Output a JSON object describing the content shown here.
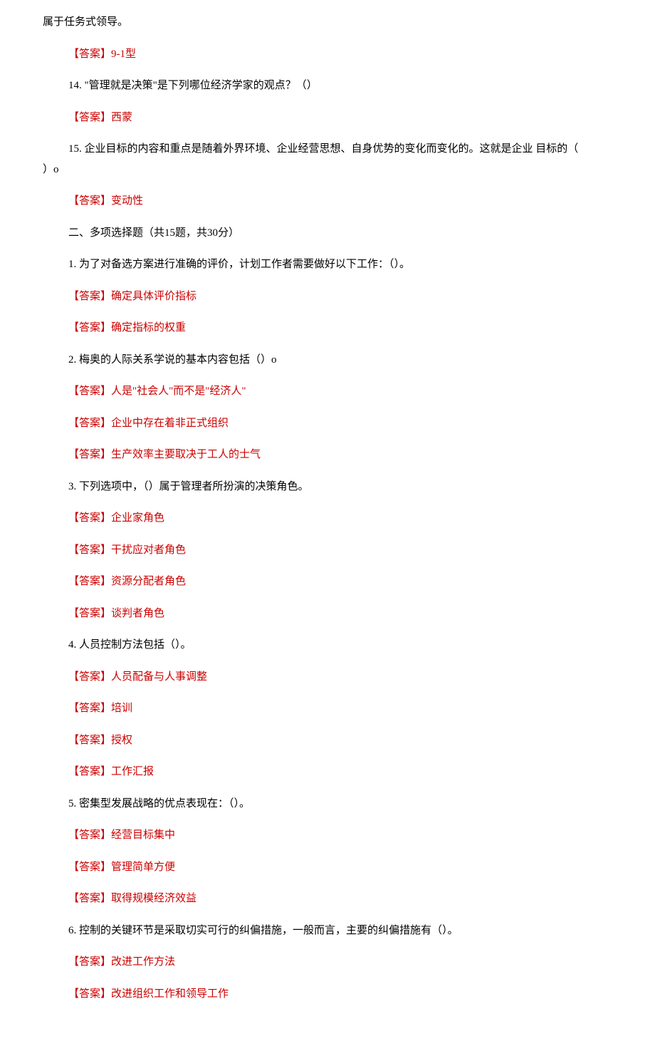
{
  "lines": {
    "l1": "属于任务式领导。",
    "l2_tag": "【答案】",
    "l2_ans": "9-1型",
    "l3": "14. \"管理就是决策\"是下列哪位经济学家的观点？（）",
    "l4_tag": "【答案】",
    "l4_ans": "西蒙",
    "l5a": "15. 企业目标的内容和重点是随着外界环境、企业经营思想、自身优势的变化而变化的。这就是企业 目标的（",
    "l5b": "）o",
    "l6_tag": "【答案】",
    "l6_ans": "变动性",
    "l7": "二、多项选择题（共15题，共30分）",
    "l8": "1. 为了对备选方案进行准确的评价，计划工作者需要做好以下工作：（）。",
    "l9_tag": "【答案】",
    "l9_ans": "确定具体评价指标",
    "l10_tag": "【答案】",
    "l10_ans": "确定指标的权重",
    "l11": "2. 梅奥的人际关系学说的基本内容包括（）o",
    "l12_tag": "【答案】",
    "l12_ans": "人是\"社会人\"而不是\"经济人\"",
    "l13_tag": "【答案】",
    "l13_ans": "企业中存在着非正式组织",
    "l14_tag": "【答案】",
    "l14_ans": "生产效率主要取决于工人的士气",
    "l15": "3. 下列选项中，（）属于管理者所扮演的决策角色。",
    "l16_tag": "【答案】",
    "l16_ans": "企业家角色",
    "l17_tag": "【答案】",
    "l17_ans": "干扰应对者角色",
    "l18_tag": "【答案】",
    "l18_ans": "资源分配者角色",
    "l19_tag": "【答案】",
    "l19_ans": "谈判者角色",
    "l20": "4. 人员控制方法包括（）。",
    "l21_tag": "【答案】",
    "l21_ans": "人员配备与人事调整",
    "l22_tag": "【答案】",
    "l22_ans": "培训",
    "l23_tag": "【答案】",
    "l23_ans": "授权",
    "l24_tag": "【答案】",
    "l24_ans": "工作汇报",
    "l25": "5. 密集型发展战略的优点表现在：（）。",
    "l26_tag": "【答案】",
    "l26_ans": "经营目标集中",
    "l27_tag": "【答案】",
    "l27_ans": "管理简单方便",
    "l28_tag": "【答案】",
    "l28_ans": "取得规模经济效益",
    "l29": "6. 控制的关键环节是采取切实可行的纠偏措施，一般而言，主要的纠偏措施有（）。",
    "l30_tag": "【答案】",
    "l30_ans": "改进工作方法",
    "l31_tag": "【答案】",
    "l31_ans": "改进组织工作和领导工作"
  }
}
